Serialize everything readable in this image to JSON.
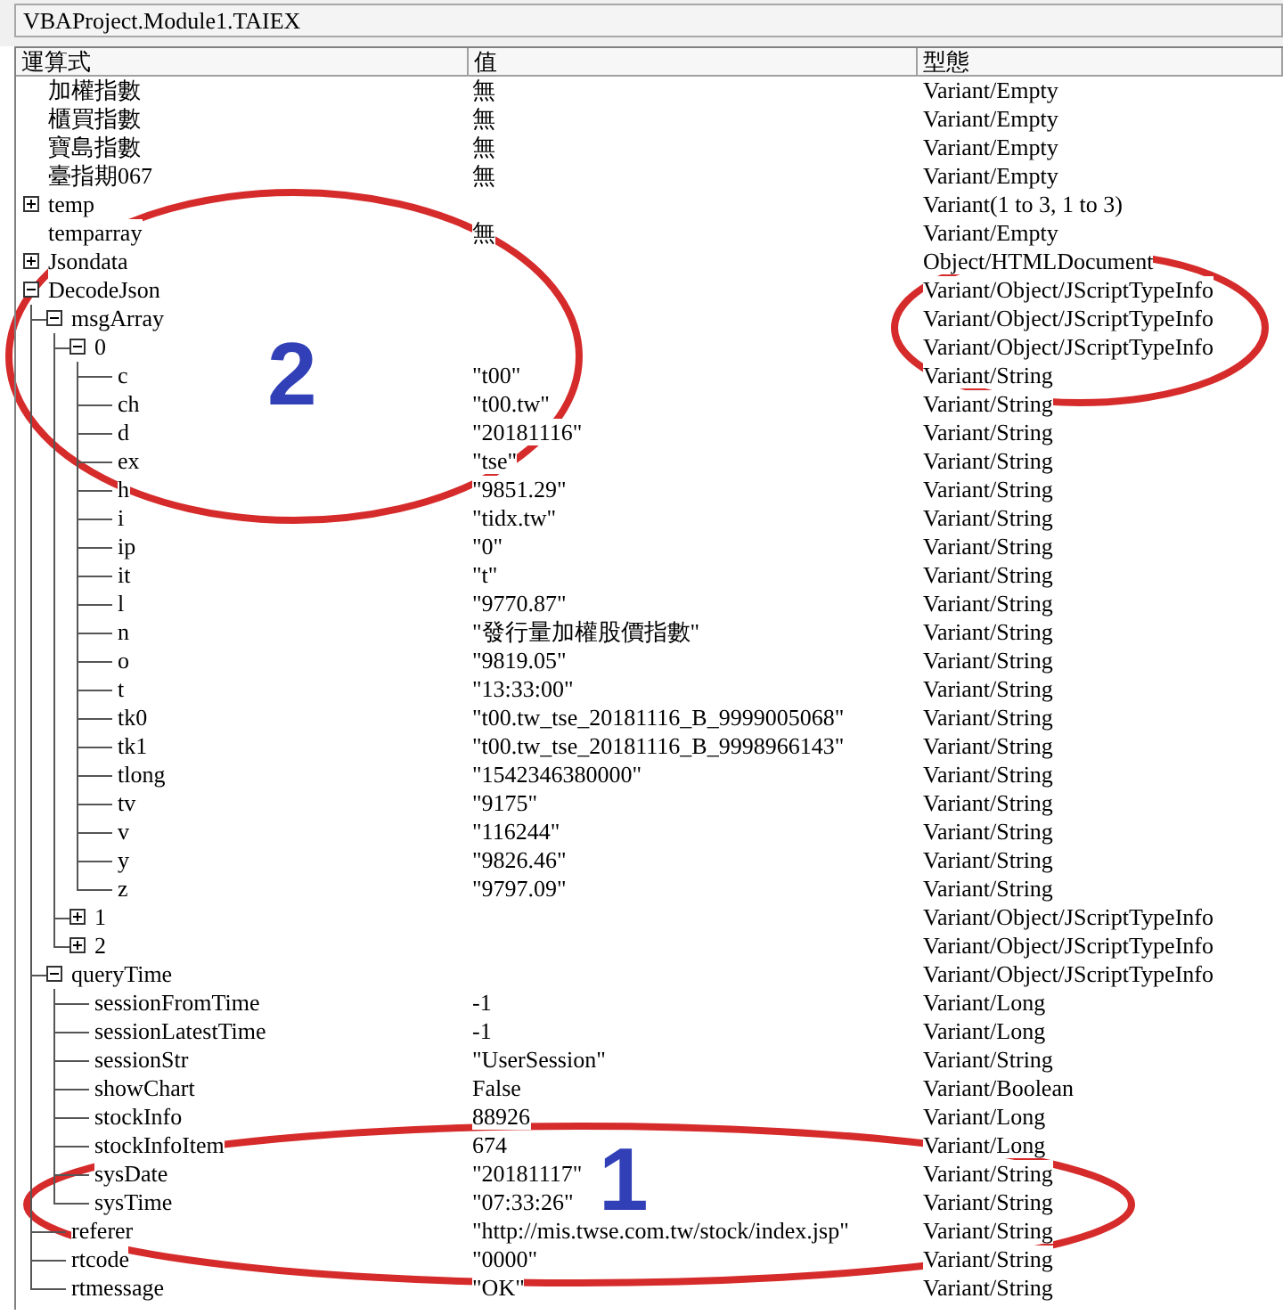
{
  "window": {
    "title": "VBAProject.Module1.TAIEX"
  },
  "columns": [
    "運算式",
    "值",
    "型態"
  ],
  "rows": [
    {
      "name": "加權指數",
      "value": "無",
      "type": "Variant/Empty"
    },
    {
      "name": "櫃買指數",
      "value": "無",
      "type": "Variant/Empty"
    },
    {
      "name": "寶島指數",
      "value": "無",
      "type": "Variant/Empty"
    },
    {
      "name": "臺指期067",
      "value": "無",
      "type": "Variant/Empty"
    },
    {
      "name": "temp",
      "type": "Variant(1 to 3, 1 to 3)",
      "expanded": false
    },
    {
      "name": "temparray",
      "value": "無",
      "type": "Variant/Empty"
    },
    {
      "name": "Jsondata",
      "type": "Object/HTMLDocument",
      "expanded": false
    },
    {
      "name": "DecodeJson",
      "type": "Variant/Object/JScriptTypeInfo",
      "expanded": true,
      "children": [
        {
          "name": "msgArray",
          "type": "Variant/Object/JScriptTypeInfo",
          "expanded": true,
          "children": [
            {
              "name": "0",
              "type": "Variant/Object/JScriptTypeInfo",
              "expanded": true,
              "children": [
                {
                  "name": "c",
                  "value": "\"t00\"",
                  "type": "Variant/String"
                },
                {
                  "name": "ch",
                  "value": "\"t00.tw\"",
                  "type": "Variant/String"
                },
                {
                  "name": "d",
                  "value": "\"20181116\"",
                  "type": "Variant/String"
                },
                {
                  "name": "ex",
                  "value": "\"tse\"",
                  "type": "Variant/String"
                },
                {
                  "name": "h",
                  "value": "\"9851.29\"",
                  "type": "Variant/String"
                },
                {
                  "name": "i",
                  "value": "\"tidx.tw\"",
                  "type": "Variant/String"
                },
                {
                  "name": "ip",
                  "value": "\"0\"",
                  "type": "Variant/String"
                },
                {
                  "name": "it",
                  "value": "\"t\"",
                  "type": "Variant/String"
                },
                {
                  "name": "l",
                  "value": "\"9770.87\"",
                  "type": "Variant/String"
                },
                {
                  "name": "n",
                  "value": "\"發行量加權股價指數\"",
                  "type": "Variant/String"
                },
                {
                  "name": "o",
                  "value": "\"9819.05\"",
                  "type": "Variant/String"
                },
                {
                  "name": "t",
                  "value": "\"13:33:00\"",
                  "type": "Variant/String"
                },
                {
                  "name": "tk0",
                  "value": "\"t00.tw_tse_20181116_B_9999005068\"",
                  "type": "Variant/String"
                },
                {
                  "name": "tk1",
                  "value": "\"t00.tw_tse_20181116_B_9998966143\"",
                  "type": "Variant/String"
                },
                {
                  "name": "tlong",
                  "value": "\"1542346380000\"",
                  "type": "Variant/String"
                },
                {
                  "name": "tv",
                  "value": "\"9175\"",
                  "type": "Variant/String"
                },
                {
                  "name": "v",
                  "value": "\"116244\"",
                  "type": "Variant/String"
                },
                {
                  "name": "y",
                  "value": "\"9826.46\"",
                  "type": "Variant/String"
                },
                {
                  "name": "z",
                  "value": "\"9797.09\"",
                  "type": "Variant/String"
                }
              ]
            },
            {
              "name": "1",
              "type": "Variant/Object/JScriptTypeInfo",
              "expanded": false
            },
            {
              "name": "2",
              "type": "Variant/Object/JScriptTypeInfo",
              "expanded": false
            }
          ]
        },
        {
          "name": "queryTime",
          "type": "Variant/Object/JScriptTypeInfo",
          "expanded": true,
          "children": [
            {
              "name": "sessionFromTime",
              "value": "-1",
              "type": "Variant/Long"
            },
            {
              "name": "sessionLatestTime",
              "value": "-1",
              "type": "Variant/Long"
            },
            {
              "name": "sessionStr",
              "value": "\"UserSession\"",
              "type": "Variant/String"
            },
            {
              "name": "showChart",
              "value": "False",
              "type": "Variant/Boolean"
            },
            {
              "name": "stockInfo",
              "value": "88926",
              "type": "Variant/Long"
            },
            {
              "name": "stockInfoItem",
              "value": "674",
              "type": "Variant/Long"
            },
            {
              "name": "sysDate",
              "value": "\"20181117\"",
              "type": "Variant/String"
            },
            {
              "name": "sysTime",
              "value": "\"07:33:26\"",
              "type": "Variant/String"
            }
          ]
        },
        {
          "name": "referer",
          "value": "\"http://mis.twse.com.tw/stock/index.jsp\"",
          "type": "Variant/String"
        },
        {
          "name": "rtcode",
          "value": "\"0000\"",
          "type": "Variant/String"
        },
        {
          "name": "rtmessage",
          "value": "\"OK\"",
          "type": "Variant/String"
        }
      ]
    }
  ],
  "annotations": [
    {
      "kind": "ellipse",
      "label": "1"
    },
    {
      "kind": "ellipse",
      "label": "2"
    },
    {
      "kind": "ellipse"
    }
  ]
}
